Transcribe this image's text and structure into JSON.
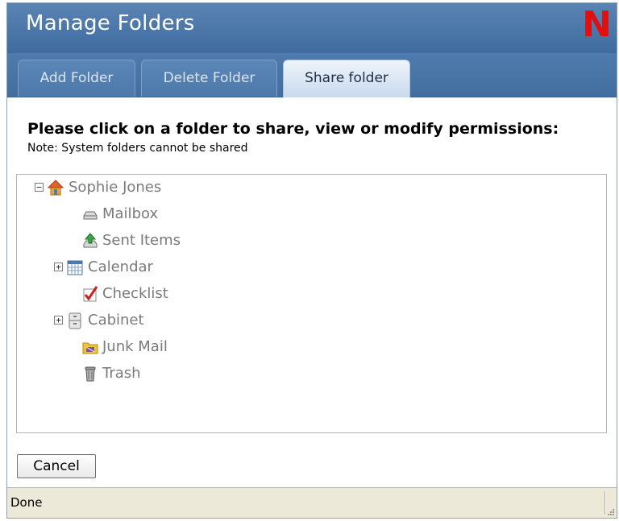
{
  "window": {
    "title": "Manage Folders",
    "logo_text": "N"
  },
  "tabs": [
    {
      "label": "Add Folder"
    },
    {
      "label": "Delete Folder"
    },
    {
      "label": "Share folder",
      "active": true
    }
  ],
  "instructions": {
    "heading": "Please click on a folder to share, view or modify permissions:",
    "note": "Note: System folders cannot be shared"
  },
  "tree": {
    "root": {
      "label": "Sophie Jones",
      "icon": "home-icon",
      "expander": "⊟"
    },
    "items": [
      {
        "label": "Mailbox",
        "icon": "mailbox-icon"
      },
      {
        "label": "Sent Items",
        "icon": "sent-items-icon"
      },
      {
        "label": "Calendar",
        "icon": "calendar-icon",
        "expander": "+"
      },
      {
        "label": "Checklist",
        "icon": "checkmark-icon"
      },
      {
        "label": "Cabinet",
        "icon": "cabinet-icon",
        "expander": "+"
      },
      {
        "label": "Junk Mail",
        "icon": "junk-folder-icon"
      },
      {
        "label": "Trash",
        "icon": "trash-icon"
      }
    ]
  },
  "buttons": {
    "cancel": "Cancel"
  },
  "status": {
    "text": "Done"
  },
  "colors": {
    "titlebar": "#4a76a8",
    "logo": "#e01010",
    "tree_text": "#7a7a7a",
    "active_tab": "#dce8f5"
  }
}
